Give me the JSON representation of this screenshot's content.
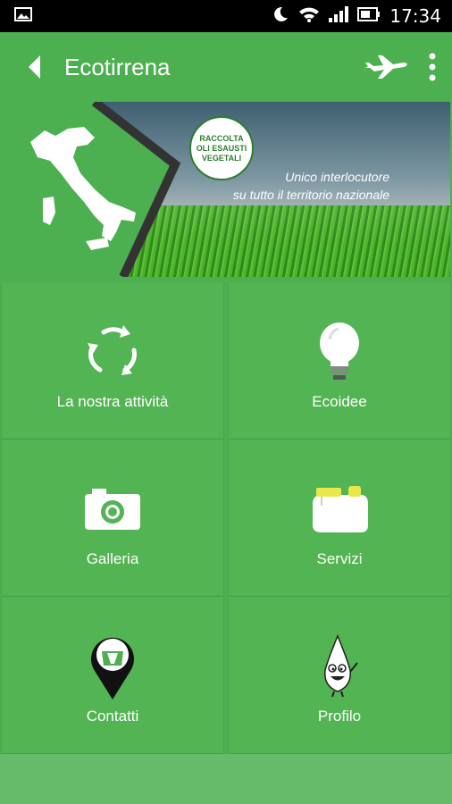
{
  "status_bar": {
    "time": "17:34"
  },
  "app_bar": {
    "title": "Ecotirrena"
  },
  "banner": {
    "badge_lines": [
      "RACCOLTA",
      "OLI ESAUSTI",
      "VEGETALI"
    ],
    "tagline_lines": [
      "Unico interlocutore",
      "su tutto il territorio nazionale"
    ]
  },
  "tiles": [
    {
      "label": "La nostra attività",
      "icon": "recycle-icon"
    },
    {
      "label": "Ecoidee",
      "icon": "lightbulb-icon"
    },
    {
      "label": "Galleria",
      "icon": "camera-icon"
    },
    {
      "label": "Servizi",
      "icon": "container-icon"
    },
    {
      "label": "Contatti",
      "icon": "map-pin-icon"
    },
    {
      "label": "Profilo",
      "icon": "oil-drop-mascot-icon"
    }
  ]
}
